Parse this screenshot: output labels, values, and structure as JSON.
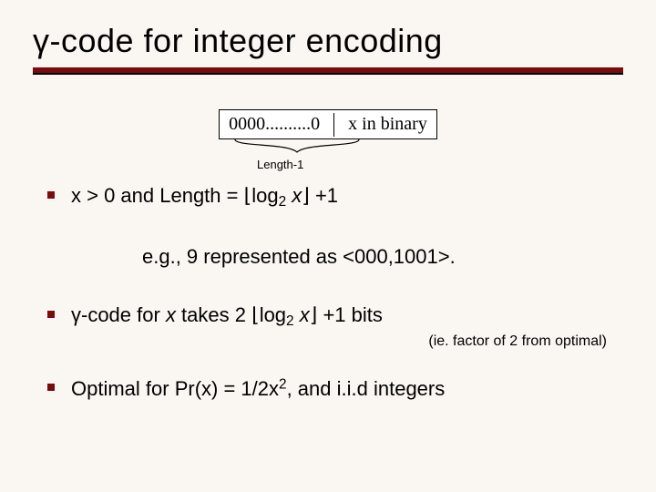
{
  "title": "γ-code for integer encoding",
  "diagram": {
    "zeros_cell": "0000..........0",
    "binary_cell": "x in binary",
    "brace_label": "Length-1"
  },
  "bullet1": {
    "prefix": "x > 0 and Length = ",
    "floor_open": "⌊",
    "log": "log",
    "log_sub": "2",
    "var": " x",
    "floor_close": "⌋",
    "suffix": " +1"
  },
  "example": "e.g., 9 represented as <000,1001>.",
  "bullet2": {
    "prefix": "γ-code for ",
    "var": "x",
    "mid": " takes 2 ",
    "floor_open": "⌊",
    "log": "log",
    "log_sub": "2",
    "var2": " x",
    "floor_close": "⌋",
    "suffix": " +1 bits"
  },
  "aside": "(ie. factor of 2 from optimal)",
  "bullet3": "Optimal for Pr(x) = 1/2x², and i.i.d integers"
}
